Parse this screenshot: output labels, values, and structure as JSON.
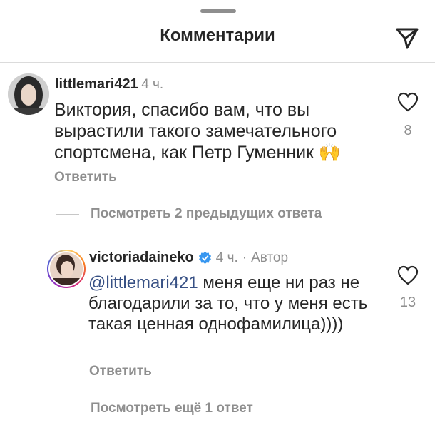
{
  "header": {
    "title": "Комментарии",
    "send_icon": "paper-plane-icon"
  },
  "comment": {
    "username": "littlemari421",
    "time": "4 ч.",
    "text": "Виктория, спасибо вам, что вы вырастили такого замечательного спортсмена, как Петр Гуменник",
    "emoji": "🙌",
    "likes": "8",
    "reply_label": "Ответить"
  },
  "view_previous": {
    "label": "Посмотреть 2 предыдущих ответа"
  },
  "reply": {
    "username": "victoriadaineko",
    "verified_icon": "verified-badge-icon",
    "time": "4 ч.",
    "separator": "·",
    "author_label": "Автор",
    "mention": "@littlemari421",
    "text": " меня еще ни раз не благодарили за то, что у меня есть такая ценная однофамилица))))",
    "likes": "13",
    "reply_label": "Ответить"
  },
  "view_more": {
    "label": "Посмотреть ещё 1 ответ"
  },
  "colors": {
    "mention": "#385185",
    "muted": "#8e8e8e",
    "verified": "#3897f0"
  }
}
